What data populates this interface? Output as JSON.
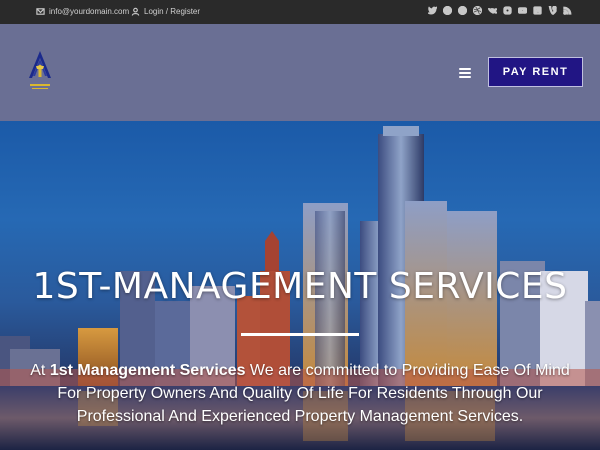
{
  "topbar": {
    "email": "info@yourdomain.com",
    "login": "Login / Register",
    "social_icons": [
      "twitter-icon",
      "facebook-icon",
      "pinterest-icon",
      "dribbble-icon",
      "vk-icon",
      "instagram-icon",
      "youtube-icon",
      "vimeo-square-icon",
      "vimeo-icon",
      "rss-icon"
    ]
  },
  "header": {
    "menu_icon": "hamburger-menu-icon",
    "pay_rent": "PAY RENT"
  },
  "hero": {
    "title": "1ST-MANAGEMENT SERVICES",
    "desc_prefix": "At ",
    "desc_company": "1st Management Services",
    "desc_rest": " We are committed to Providing Ease Of Mind For Property Owners And Quality Of Life For Residents Through Our Professional And Experienced Property Management Services."
  },
  "colors": {
    "topbar_bg": "#2a2a2a",
    "header_bg": "#6a6f94",
    "button_bg": "#211584",
    "hero_sky": "#2669b4"
  }
}
